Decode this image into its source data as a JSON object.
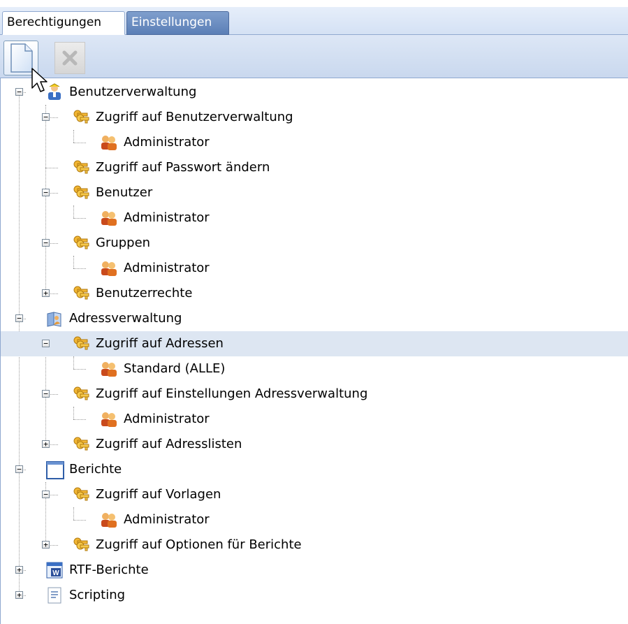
{
  "tabs": [
    {
      "label": "Berechtigungen",
      "active": true
    },
    {
      "label": "Einstellungen",
      "active": false
    }
  ],
  "toolbar": {
    "new_icon": "new-document-icon",
    "delete_icon": "delete-icon"
  },
  "tree": [
    {
      "label": "Benutzerverwaltung",
      "depth": 0,
      "state": "expanded",
      "icon": "user-admin-icon"
    },
    {
      "label": "Zugriff auf Benutzerverwaltung",
      "depth": 1,
      "state": "expanded",
      "icon": "keys-icon"
    },
    {
      "label": "Administrator",
      "depth": 2,
      "state": "leaf",
      "icon": "user-group-icon"
    },
    {
      "label": "Zugriff auf Passwort ändern",
      "depth": 1,
      "state": "leaf",
      "icon": "keys-icon"
    },
    {
      "label": "Benutzer",
      "depth": 1,
      "state": "expanded",
      "icon": "keys-icon"
    },
    {
      "label": "Administrator",
      "depth": 2,
      "state": "leaf",
      "icon": "user-group-icon"
    },
    {
      "label": "Gruppen",
      "depth": 1,
      "state": "expanded",
      "icon": "keys-icon"
    },
    {
      "label": "Administrator",
      "depth": 2,
      "state": "leaf",
      "icon": "user-group-icon"
    },
    {
      "label": "Benutzerrechte",
      "depth": 1,
      "state": "collapsed",
      "icon": "keys-icon"
    },
    {
      "label": "Adressverwaltung",
      "depth": 0,
      "state": "expanded",
      "icon": "address-book-icon"
    },
    {
      "label": "Zugriff auf Adressen",
      "depth": 1,
      "state": "expanded",
      "icon": "keys-icon",
      "selected": true
    },
    {
      "label": "Standard (ALLE)",
      "depth": 2,
      "state": "leaf",
      "icon": "user-group-icon"
    },
    {
      "label": "Zugriff auf Einstellungen Adressverwaltung",
      "depth": 1,
      "state": "expanded",
      "icon": "keys-icon"
    },
    {
      "label": "Administrator",
      "depth": 2,
      "state": "leaf",
      "icon": "user-group-icon"
    },
    {
      "label": "Zugriff auf Adresslisten",
      "depth": 1,
      "state": "collapsed",
      "icon": "keys-icon"
    },
    {
      "label": "Berichte",
      "depth": 0,
      "state": "expanded",
      "icon": "report-window-icon"
    },
    {
      "label": "Zugriff auf Vorlagen",
      "depth": 1,
      "state": "expanded",
      "icon": "keys-icon"
    },
    {
      "label": "Administrator",
      "depth": 2,
      "state": "leaf",
      "icon": "user-group-icon"
    },
    {
      "label": "Zugriff auf Optionen für Berichte",
      "depth": 1,
      "state": "collapsed",
      "icon": "keys-icon"
    },
    {
      "label": "RTF-Berichte",
      "depth": 0,
      "state": "collapsed",
      "icon": "word-document-icon"
    },
    {
      "label": "Scripting",
      "depth": 0,
      "state": "collapsed",
      "icon": "script-document-icon"
    }
  ],
  "colors": {
    "selection": "#dde6f2",
    "tab_inactive": "#5b7fb6",
    "header_bg": "#d4e1f4"
  }
}
